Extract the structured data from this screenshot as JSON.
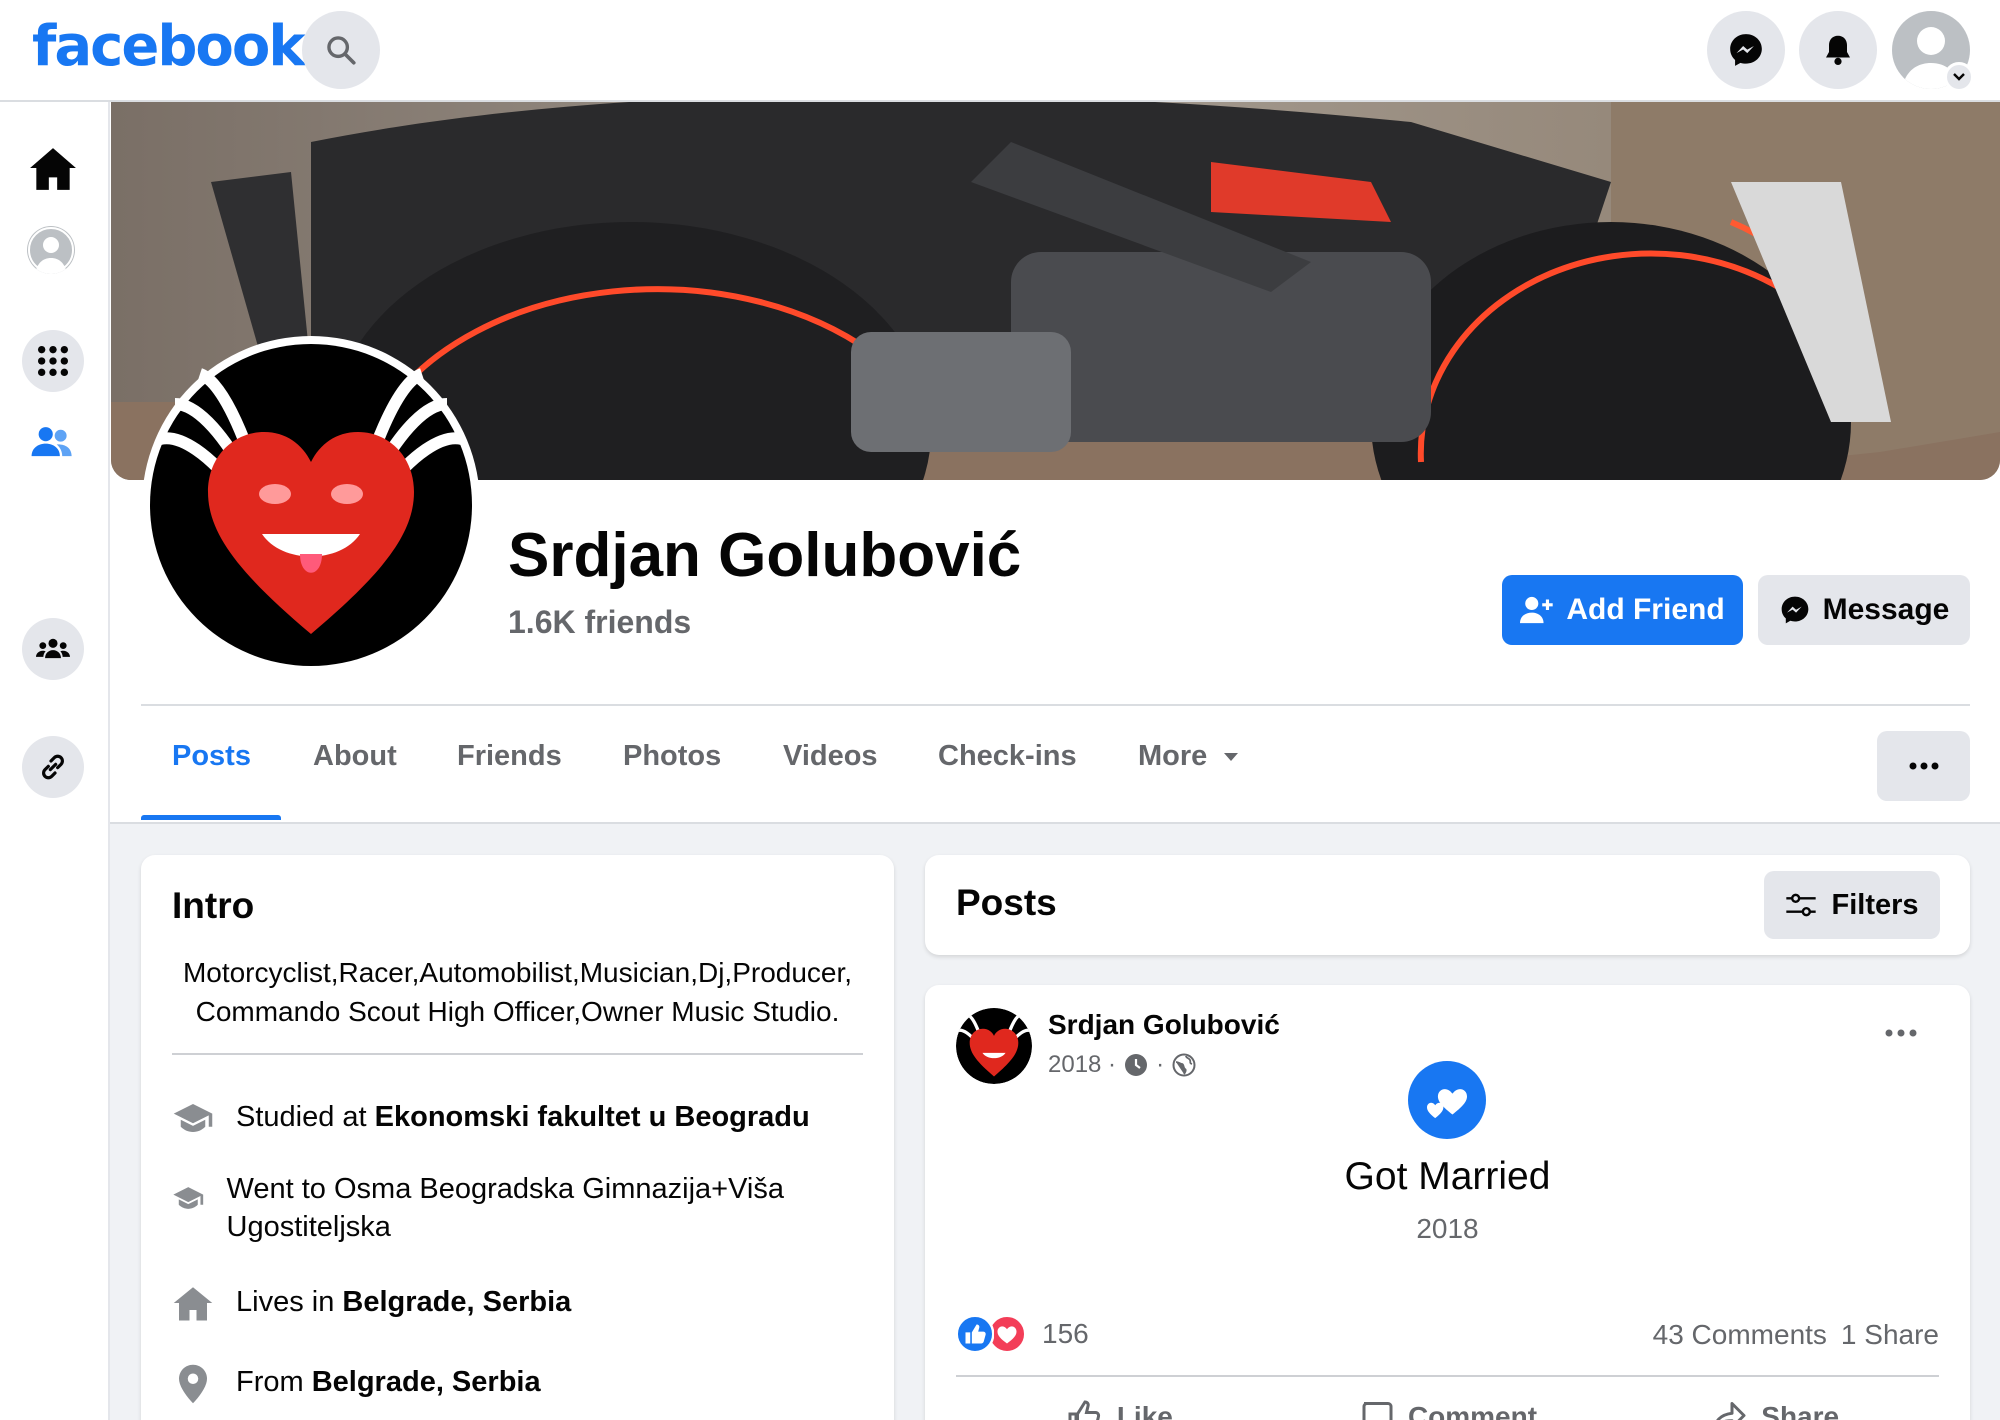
{
  "header": {
    "logo_text": "facebook",
    "brand_color": "#1877f2",
    "icons": [
      "search-icon",
      "messenger-icon",
      "bell-icon",
      "account-avatar"
    ]
  },
  "leftnav": {
    "icons": [
      "home-icon",
      "profile-icon",
      "apps-grid-icon",
      "friends-icon",
      "groups-icon",
      "link-icon"
    ]
  },
  "profile": {
    "name": "Srdjan Golubović",
    "friends_count": "1.6K friends",
    "add_friend_label": "Add Friend",
    "message_label": "Message"
  },
  "tabs": [
    {
      "label": "Posts",
      "active": true
    },
    {
      "label": "About"
    },
    {
      "label": "Friends"
    },
    {
      "label": "Photos"
    },
    {
      "label": "Videos"
    },
    {
      "label": "Check-ins"
    },
    {
      "label": "More"
    }
  ],
  "intro": {
    "title": "Intro",
    "bio_line1": "Motorcyclist,Racer,Automobilist,Musician,Dj,Producer,",
    "bio_line2": "Commando Scout High Officer,Owner Music Studio.",
    "items": [
      {
        "prefix": "Studied at ",
        "bold": "Ekonomski fakultet u Beogradu"
      },
      {
        "prefix": "Went to Osma Beogradska Gimnazija+Viša Ugostiteljska",
        "bold": ""
      },
      {
        "prefix": "Lives in ",
        "bold": "Belgrade, Serbia"
      },
      {
        "prefix": "From ",
        "bold": "Belgrade, Serbia"
      }
    ]
  },
  "posts_header": {
    "title": "Posts",
    "filters_label": "Filters"
  },
  "post": {
    "author": "Srdjan Golubović",
    "date": "2018 ·",
    "dot": "·",
    "event_title": "Got Married",
    "event_year": "2018",
    "reaction_count": "156",
    "comments": "43 Comments",
    "shares": "1 Share",
    "like_label": "Like",
    "comment_label": "Comment",
    "share_label": "Share"
  }
}
